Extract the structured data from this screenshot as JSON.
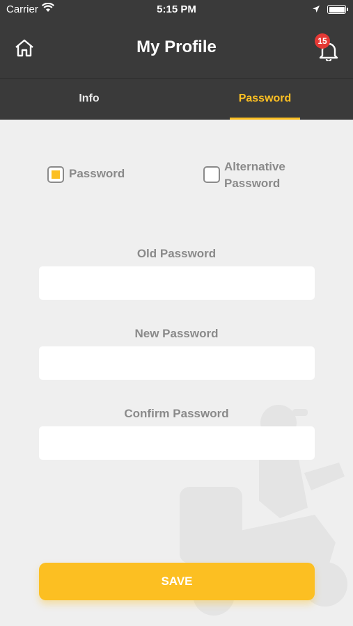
{
  "status_bar": {
    "carrier": "Carrier",
    "time": "5:15 PM"
  },
  "header": {
    "title": "My Profile",
    "notification_count": "15"
  },
  "tabs": [
    {
      "label": "Info",
      "active": false
    },
    {
      "label": "Password",
      "active": true
    }
  ],
  "password_type": {
    "option_password": "Password",
    "option_alternative_line1": "Alternative",
    "option_alternative_line2": "Password",
    "selected": "Password"
  },
  "form": {
    "old_password_label": "Old Password",
    "new_password_label": "New Password",
    "confirm_password_label": "Confirm Password",
    "old_password_value": "",
    "new_password_value": "",
    "confirm_password_value": ""
  },
  "actions": {
    "save_label": "SAVE"
  },
  "colors": {
    "accent": "#fcbf22",
    "header_bg": "#3a3a3a",
    "page_bg": "#efefef",
    "badge": "#e53935"
  }
}
